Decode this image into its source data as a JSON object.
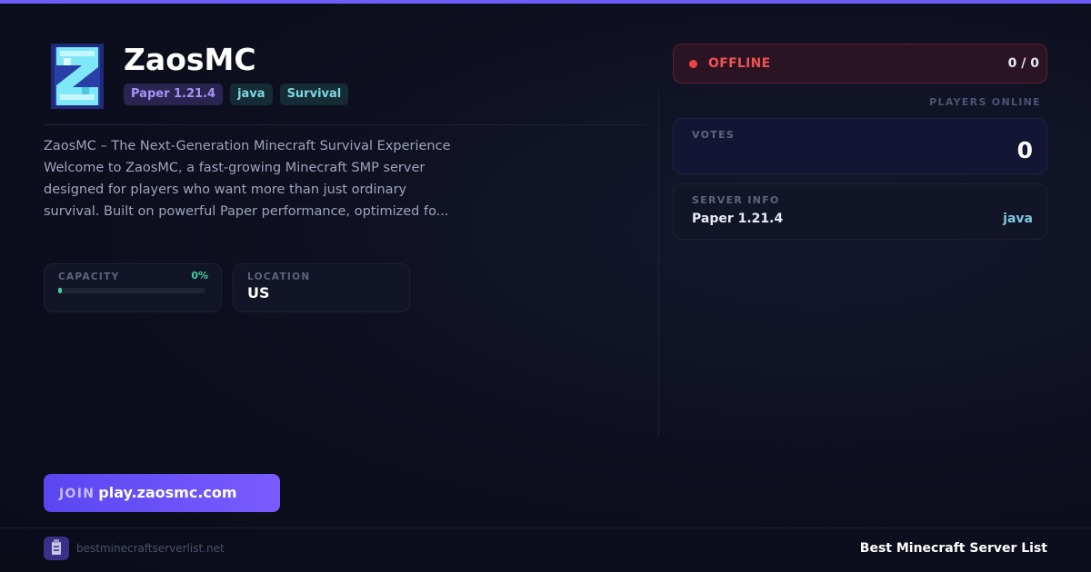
{
  "server": {
    "name": "ZaosMC",
    "tags": [
      "Paper 1.21.4",
      "java",
      "Survival"
    ],
    "description": "ZaosMC – The Next-Generation Minecraft Survival Experience Welcome to ZaosMC, a fast-growing Minecraft SMP server designed for players who want more than just ordinary survival. Built on powerful Paper performance, optimized fo..."
  },
  "capacity": {
    "label": "CAPACITY",
    "percent_text": "0%",
    "percent": 0
  },
  "location": {
    "label": "LOCATION",
    "value": "US"
  },
  "status": {
    "text": "OFFLINE",
    "count": "0 / 0",
    "players_label": "PLAYERS ONLINE"
  },
  "votes": {
    "label": "VOTES",
    "value": "0"
  },
  "server_info": {
    "label": "SERVER INFO",
    "software": "Paper 1.21.4",
    "edition": "java"
  },
  "join": {
    "prefix": "JOIN",
    "address": "play.zaosmc.com"
  },
  "footer": {
    "site": "bestminecraftserverlist.net",
    "brand": "Best Minecraft Server List"
  },
  "colors": {
    "accent": "#6d5cf6",
    "offline": "#ef4444",
    "capacity": "#3fd0a0",
    "edition": "#7ec8e0"
  },
  "icons": {
    "logo": "zaosmc-logo",
    "footer": "server-list-logo-icon",
    "status": "status-dot"
  }
}
